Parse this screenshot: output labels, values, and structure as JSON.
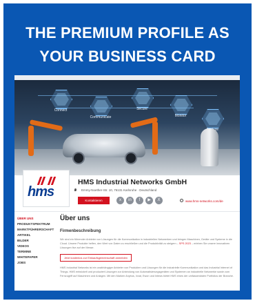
{
  "headline": {
    "line1": "THE PREMIUM PROFILE AS",
    "line2": "YOUR BUSINESS CARD"
  },
  "hero": {
    "hexagons": [
      "Connect",
      "Communicate",
      "Secure",
      "Monitor",
      "Analyze"
    ]
  },
  "profile": {
    "logo_text": "hms",
    "company_name": "HMS Industrial Networks GmbH",
    "address": "Emmy-Noether-Str. 10, 76131 Karlsruhe · Deutschland",
    "contact_button": "Kontaktieren",
    "social_icons": [
      "xing-icon",
      "linkedin-icon",
      "facebook-icon",
      "youtube-icon",
      "x-icon"
    ],
    "website": "www.hms-networks.com/de"
  },
  "sidebar": {
    "items": [
      {
        "label": "Über uns",
        "active": true
      },
      {
        "label": "Produktspektrum",
        "active": false
      },
      {
        "label": "Marktführerschaft",
        "active": false
      },
      {
        "label": "Artikel",
        "active": false
      },
      {
        "label": "Bilder",
        "active": false
      },
      {
        "label": "Videos",
        "active": false
      },
      {
        "label": "Termine",
        "active": false
      },
      {
        "label": "Whitepaper",
        "active": false
      },
      {
        "label": "Jobs",
        "active": false
      }
    ]
  },
  "content": {
    "heading": "Über uns",
    "subheading": "Firmenbeschreibung",
    "para1_a": "Wir sind ein führender Anbieter von Lösungen für die Kommunikation in industriellen Netzwerken und bringen Maschinen, Geräte und Systeme in die Cloud. Unsere Produkte helfen, den Wert von Daten zu erschließen und die Produktivität zu steigern – ",
    "para1_hl": "SPS 2023",
    "para1_b": " – erleben Sie unsere innovativen Lösungen live auf der Messe.",
    "cta": "Jetzt kostenlos zur Einkaufsgemeinschaft anmelden",
    "para2": "HMS Industrial Networks ist ein unabhängiger Anbieter von Produkten und Lösungen für die industrielle Kommunikation und das Industrial Internet of Things. HMS entwickelt und produziert Lösungen zur Anbindung von Automatisierungsgeräten und Systemen an industrielle Netzwerke sowie zum Fernzugriff auf Maschinen und Anlagen. Mit den Marken Anybus, Ixxat, Ewon und Intesis bietet HMS eines der umfassendsten Portfolios der Branche."
  },
  "colors": {
    "card_blue": "#0a57b3",
    "brand_red": "#d3121f",
    "logo_blue": "#0b3d91"
  }
}
